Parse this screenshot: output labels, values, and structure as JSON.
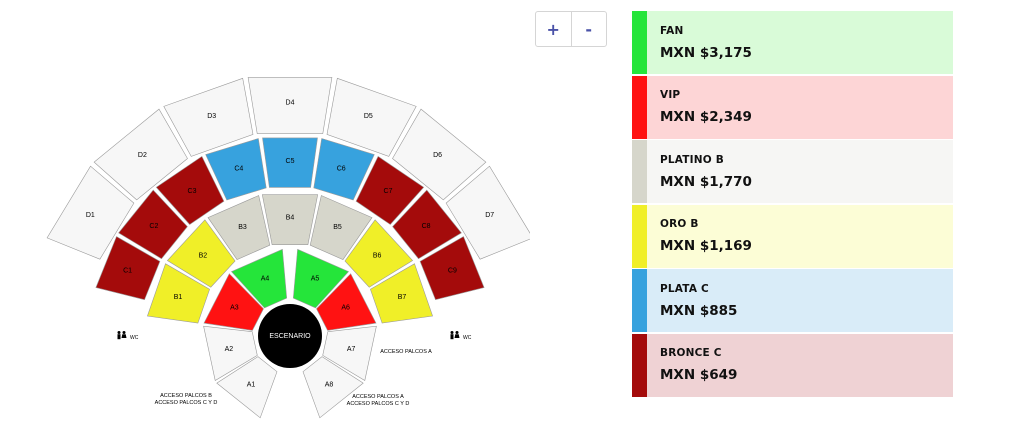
{
  "zoom": {
    "in_label": "+",
    "out_label": "-"
  },
  "stage": {
    "label": "ESCENARIO",
    "color": "#000000"
  },
  "tiers": {
    "fan": {
      "color": "#25e53a"
    },
    "vip": {
      "color": "#ff1212"
    },
    "platino": {
      "color": "#d6d6cb"
    },
    "oro": {
      "color": "#f0ef28"
    },
    "plata": {
      "color": "#37a2de"
    },
    "bronce": {
      "color": "#a40b0b"
    },
    "general": {
      "color": "#f7f7f7"
    }
  },
  "sections": {
    "ring_a_left": [
      {
        "label": "A1",
        "tier": "general"
      },
      {
        "label": "A2",
        "tier": "general"
      },
      {
        "label": "A3",
        "tier": "vip"
      },
      {
        "label": "A4",
        "tier": "fan"
      }
    ],
    "ring_a_right": [
      {
        "label": "A5",
        "tier": "fan"
      },
      {
        "label": "A6",
        "tier": "vip"
      },
      {
        "label": "A7",
        "tier": "general"
      },
      {
        "label": "A8",
        "tier": "general"
      }
    ],
    "ring_b": [
      {
        "label": "B1",
        "tier": "oro"
      },
      {
        "label": "B2",
        "tier": "oro"
      },
      {
        "label": "B3",
        "tier": "platino"
      },
      {
        "label": "B4",
        "tier": "platino"
      },
      {
        "label": "B5",
        "tier": "platino"
      },
      {
        "label": "B6",
        "tier": "oro"
      },
      {
        "label": "B7",
        "tier": "oro"
      }
    ],
    "ring_c": [
      {
        "label": "C1",
        "tier": "bronce"
      },
      {
        "label": "C2",
        "tier": "bronce"
      },
      {
        "label": "C3",
        "tier": "bronce"
      },
      {
        "label": "C4",
        "tier": "plata"
      },
      {
        "label": "C5",
        "tier": "plata"
      },
      {
        "label": "C6",
        "tier": "plata"
      },
      {
        "label": "C7",
        "tier": "bronce"
      },
      {
        "label": "C8",
        "tier": "bronce"
      },
      {
        "label": "C9",
        "tier": "bronce"
      }
    ],
    "ring_d": [
      {
        "label": "D1",
        "tier": "general"
      },
      {
        "label": "D2",
        "tier": "general"
      },
      {
        "label": "D3",
        "tier": "general"
      },
      {
        "label": "D4",
        "tier": "general"
      },
      {
        "label": "D5",
        "tier": "general"
      },
      {
        "label": "D6",
        "tier": "general"
      },
      {
        "label": "D7",
        "tier": "general"
      }
    ]
  },
  "notes": {
    "wc": "WC",
    "acceso_a_right": "ACCESO PALCOS A",
    "bottom_left_line1": "ACCESO PALCOS B",
    "bottom_left_line2": "ACCESO PALCOS C Y D",
    "bottom_right_line1": "ACCESO PALCOS A",
    "bottom_right_line2": "ACCESO PALCOS C Y D"
  },
  "legend": [
    {
      "name": "FAN",
      "price": "MXN $3,175",
      "color": "#25e53a",
      "bg": "#d9fbd8"
    },
    {
      "name": "VIP",
      "price": "MXN $2,349",
      "color": "#ff1212",
      "bg": "#fdd5d6"
    },
    {
      "name": "PLATINO B",
      "price": "MXN $1,770",
      "color": "#d6d6cb",
      "bg": "#f6f6f4"
    },
    {
      "name": "ORO B",
      "price": "MXN $1,169",
      "color": "#f0ef28",
      "bg": "#fcfdd6"
    },
    {
      "name": "PLATA C",
      "price": "MXN $885",
      "color": "#37a2de",
      "bg": "#d9ecf8"
    },
    {
      "name": "BRONCE C",
      "price": "MXN $649",
      "color": "#a40b0b",
      "bg": "#efd2d4"
    }
  ]
}
